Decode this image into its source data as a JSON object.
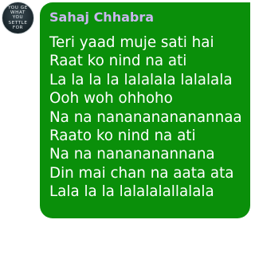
{
  "avatar": {
    "lines": [
      "YOU GE",
      "WHAT",
      "YOU",
      "SETTLE",
      "FOR"
    ]
  },
  "message": {
    "sender": "Sahaj Chhabra",
    "lines": [
      "Teri yaad muje sati hai",
      "Raat ko nind na ati",
      "La la la la lalalala lalalala",
      "Ooh woh ohhoho",
      "Na na nanananananannaa",
      "Raato ko nind na ati",
      "Na na nanananannana",
      "Din mai chan na aata ata",
      "Lala la la lalalalallalala"
    ]
  },
  "colors": {
    "bubble": "#0a8f0a",
    "sender_name": "#c9b6ee",
    "message_text": "#ffffff"
  }
}
